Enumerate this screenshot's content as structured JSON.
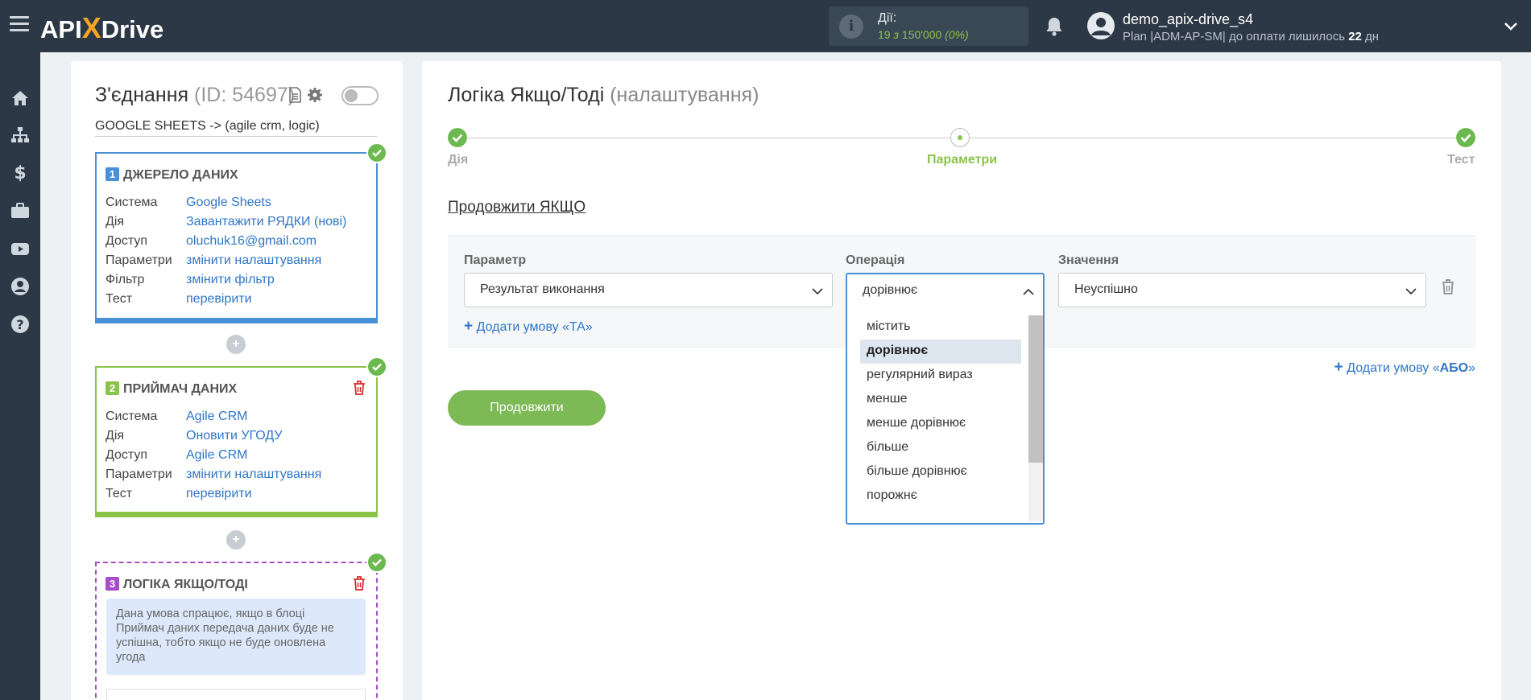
{
  "topbar": {
    "logo_prefix": "API",
    "logo_x": "X",
    "logo_suffix": "Drive",
    "actions_label": "Дії:",
    "actions_used": "19",
    "actions_of": "з",
    "actions_total": "150'000",
    "actions_percent": "(0%)",
    "username": "demo_apix-drive_s4",
    "plan_text": "Plan |ADM-AP-SM| до оплати лишилось",
    "plan_days": "22",
    "plan_days_unit": "дн"
  },
  "connection": {
    "title": "З'єднання",
    "id_text": "(ID: 54697)",
    "subtitle": "GOOGLE SHEETS -> (agile crm, logic)"
  },
  "blocks": {
    "source": {
      "number": "1",
      "title": "ДЖЕРЕЛО ДАНИХ",
      "rows": [
        {
          "k": "Система",
          "v": "Google Sheets"
        },
        {
          "k": "Дія",
          "v": "Завантажити РЯДКИ (нові)"
        },
        {
          "k": "Доступ",
          "v": "oluchuk16@gmail.com"
        },
        {
          "k": "Параметри",
          "v": "змінити налаштування"
        },
        {
          "k": "Фільтр",
          "v": "змінити фільтр"
        },
        {
          "k": "Тест",
          "v": "перевірити"
        }
      ]
    },
    "receiver": {
      "number": "2",
      "title": "ПРИЙМАЧ ДАНИХ",
      "rows": [
        {
          "k": "Система",
          "v": "Agile CRM"
        },
        {
          "k": "Дія",
          "v": "Оновити УГОДУ"
        },
        {
          "k": "Доступ",
          "v": "Agile CRM"
        },
        {
          "k": "Параметри",
          "v": "змінити налаштування"
        },
        {
          "k": "Тест",
          "v": "перевірити"
        }
      ]
    },
    "logic": {
      "number": "3",
      "title": "ЛОГІКА ЯКЩО/ТОДІ",
      "note": "Дана умова спрацює, якщо в блоці Приймач даних передача даних буде не успішна, тобто якщо не буде оновлена угода"
    }
  },
  "main": {
    "title": "Логіка Якщо/Тоді",
    "title_sub": "(налаштування)",
    "steps": [
      "Дія",
      "Параметри",
      "Тест"
    ],
    "section_title": "Продовжити ЯКЩО",
    "param_label": "Параметр",
    "param_value": "Результат виконання",
    "op_label": "Операція",
    "op_value": "дорівнює",
    "value_label": "Значення",
    "value_value": "Неуспішно",
    "add_and": "Додати умову «ТА»",
    "add_or_prefix": "Додати умову «",
    "add_or_bold": "АБО",
    "add_or_suffix": "»",
    "continue_button": "Продовжити",
    "operations": [
      "містить",
      "дорівнює",
      "регулярний вираз",
      "менше",
      "менше дорівнює",
      "більше",
      "більше дорівнює",
      "порожнє"
    ],
    "selected_operation": "дорівнює"
  },
  "colors": {
    "topbar": "#2c3845",
    "accent_green": "#7db955",
    "link_blue": "#2f76c7",
    "source_border": "#4a90d9",
    "receiver_border": "#8bc34a",
    "logic_border": "#a74fc8"
  }
}
